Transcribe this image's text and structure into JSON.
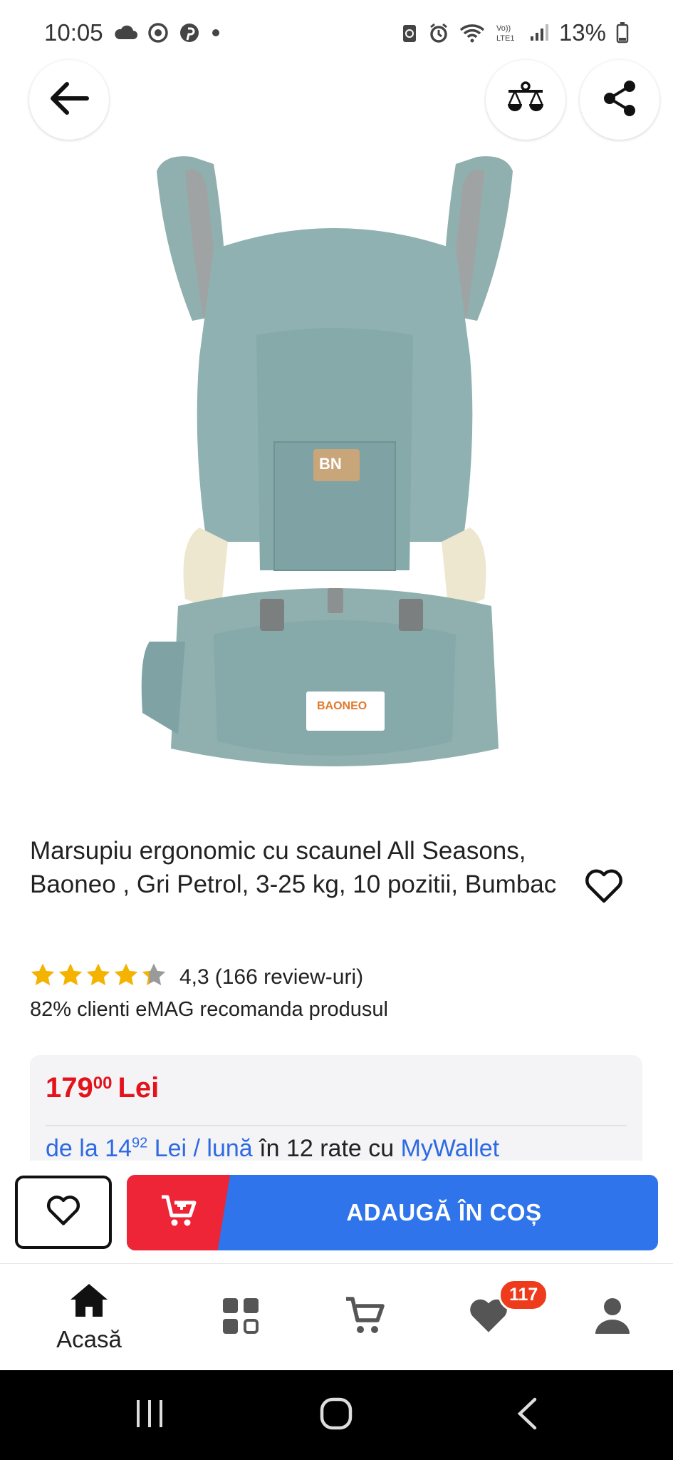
{
  "status_bar": {
    "time": "10:05",
    "battery": "13%",
    "network_label": "Vo) LTE1"
  },
  "product": {
    "title": "Marsupiu ergonomic cu scaunel All Seasons, Baoneo , Gri Petrol, 3-25 kg, 10 pozitii, Bumbac",
    "image_alt": "Marsupiu ergonomic Baoneo",
    "rating": "4,3",
    "rating_value": 4.3,
    "reviews": "(166 review-uri)",
    "recommend": "82% clienti eMAG recomanda produsul"
  },
  "price": {
    "integer": "179",
    "decimals": "00",
    "currency": "Lei"
  },
  "installment": {
    "text_prefix": "de la 14",
    "text_decimals": "92",
    "text_unit": " Lei / lună",
    "text_middle": " în 12 rate cu ",
    "provider": "MyWallet"
  },
  "actions": {
    "add_to_cart_label": "ADAUGĂ ÎN COȘ"
  },
  "bottom_nav": {
    "home_label": "Acasă",
    "favorites_badge": "117"
  },
  "colors": {
    "price_red": "#e3121b",
    "cart_blue": "#2f74ea",
    "cart_red": "#ee2536",
    "star_gold": "#f5b301",
    "badge_orange": "#ee3b1c"
  }
}
